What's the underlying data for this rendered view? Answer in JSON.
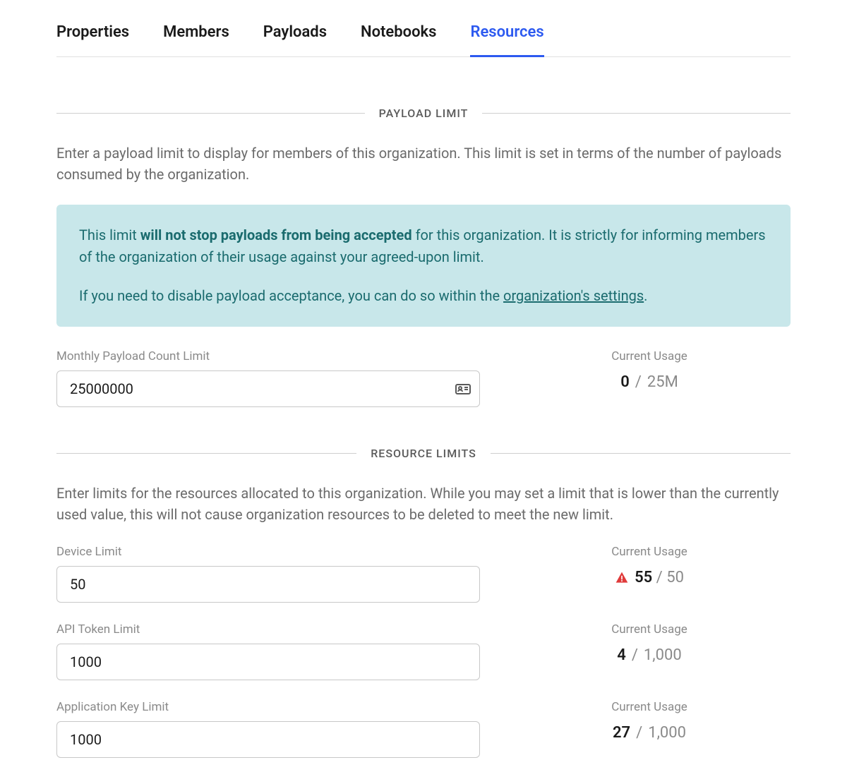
{
  "tabs": {
    "properties": "Properties",
    "members": "Members",
    "payloads": "Payloads",
    "notebooks": "Notebooks",
    "resources": "Resources"
  },
  "payload_limit": {
    "heading": "PAYLOAD LIMIT",
    "description": "Enter a payload limit to display for members of this organization. This limit is set in terms of the number of payloads consumed by the organization.",
    "info_prefix": "This limit ",
    "info_bold": "will not stop payloads from being accepted",
    "info_suffix": " for this organization. It is strictly for informing members of the organization of their usage against your agreed-upon limit.",
    "info_line2_prefix": "If you need to disable payload acceptance, you can do so within the ",
    "info_link": "organization's settings",
    "info_line2_suffix": ".",
    "field_label": "Monthly Payload Count Limit",
    "field_value": "25000000",
    "usage_label": "Current Usage",
    "usage_current": "0",
    "usage_sep": " / ",
    "usage_limit": "25M"
  },
  "resource_limits": {
    "heading": "RESOURCE LIMITS",
    "description": "Enter limits for the resources allocated to this organization. While you may set a limit that is lower than the currently used value, this will not cause organization resources to be deleted to meet the new limit.",
    "device": {
      "label": "Device Limit",
      "value": "50",
      "usage_label": "Current Usage",
      "usage_current": "55",
      "usage_sep": " / ",
      "usage_limit": "50",
      "warning": true
    },
    "api_token": {
      "label": "API Token Limit",
      "value": "1000",
      "usage_label": "Current Usage",
      "usage_current": "4",
      "usage_sep": " / ",
      "usage_limit": "1,000"
    },
    "app_key": {
      "label": "Application Key Limit",
      "value": "1000",
      "usage_label": "Current Usage",
      "usage_current": "27",
      "usage_sep": " / ",
      "usage_limit": "1,000"
    }
  }
}
